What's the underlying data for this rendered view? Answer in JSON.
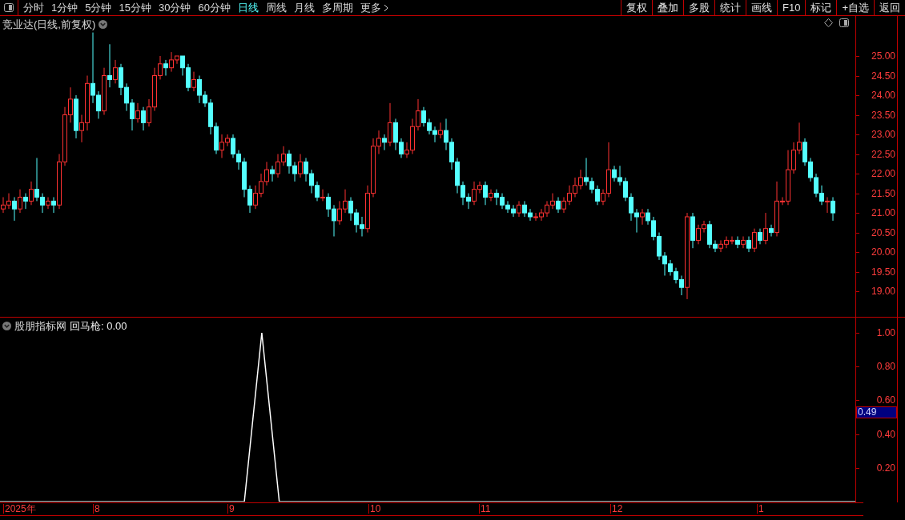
{
  "toolbar": {
    "periods": [
      {
        "label": "分时",
        "selected": false
      },
      {
        "label": "1分钟",
        "selected": false
      },
      {
        "label": "5分钟",
        "selected": false
      },
      {
        "label": "15分钟",
        "selected": false
      },
      {
        "label": "30分钟",
        "selected": false
      },
      {
        "label": "60分钟",
        "selected": false
      },
      {
        "label": "日线",
        "selected": true
      },
      {
        "label": "周线",
        "selected": false
      },
      {
        "label": "月线",
        "selected": false
      },
      {
        "label": "多周期",
        "selected": false
      }
    ],
    "more": "更多",
    "actions": [
      "复权",
      "叠加",
      "多股",
      "统计",
      "画线",
      "F10",
      "标记",
      "+自选",
      "返回"
    ]
  },
  "price_panel": {
    "title": "竞业达(日线,前复权)",
    "chart_data": {
      "type": "candlestick",
      "ylim": [
        18.35,
        26.02
      ],
      "yticks": [
        {
          "value": 25,
          "label": "25.00"
        },
        {
          "value": 24.5,
          "label": "24.50"
        },
        {
          "value": 24,
          "label": "24.00"
        },
        {
          "value": 23.5,
          "label": "23.50"
        },
        {
          "value": 23,
          "label": "23.00"
        },
        {
          "value": 22.5,
          "label": "22.50"
        },
        {
          "value": 22,
          "label": "22.00"
        },
        {
          "value": 21.5,
          "label": "21.50"
        },
        {
          "value": 21,
          "label": "21.00"
        },
        {
          "value": 20.5,
          "label": "20.50"
        },
        {
          "value": 20,
          "label": "20.00"
        },
        {
          "value": 19.5,
          "label": "19.50"
        },
        {
          "value": 19,
          "label": "19.00"
        }
      ],
      "ohlc": [
        [
          21.1,
          21.4,
          21.0,
          21.2
        ],
        [
          21.2,
          21.5,
          21.1,
          21.3
        ],
        [
          21.3,
          21.4,
          20.8,
          21.1
        ],
        [
          21.1,
          21.6,
          21.0,
          21.4
        ],
        [
          21.4,
          21.5,
          21.1,
          21.3
        ],
        [
          21.3,
          21.8,
          21.2,
          21.6
        ],
        [
          21.6,
          22.4,
          21.3,
          21.4
        ],
        [
          21.4,
          21.5,
          21.0,
          21.2
        ],
        [
          21.2,
          21.4,
          21.1,
          21.3
        ],
        [
          21.3,
          21.4,
          21.0,
          21.2
        ],
        [
          21.2,
          22.5,
          21.1,
          22.3
        ],
        [
          22.3,
          23.7,
          22.2,
          23.5
        ],
        [
          23.5,
          24.2,
          23.3,
          23.9
        ],
        [
          23.9,
          24.0,
          22.9,
          23.1
        ],
        [
          23.1,
          23.5,
          22.8,
          23.3
        ],
        [
          23.3,
          24.5,
          23.1,
          24.3
        ],
        [
          24.3,
          25.6,
          23.8,
          24.0
        ],
        [
          24.0,
          24.1,
          23.4,
          23.6
        ],
        [
          23.6,
          24.7,
          23.5,
          24.5
        ],
        [
          24.5,
          25.3,
          24.2,
          24.4
        ],
        [
          24.4,
          24.9,
          24.3,
          24.7
        ],
        [
          24.7,
          24.8,
          24.0,
          24.2
        ],
        [
          24.2,
          24.3,
          23.6,
          23.8
        ],
        [
          23.8,
          23.9,
          23.1,
          23.4
        ],
        [
          23.4,
          23.8,
          23.3,
          23.6
        ],
        [
          23.6,
          23.7,
          23.1,
          23.3
        ],
        [
          23.3,
          23.9,
          23.2,
          23.7
        ],
        [
          23.7,
          24.7,
          23.6,
          24.5
        ],
        [
          24.5,
          25.0,
          24.4,
          24.8
        ],
        [
          24.8,
          24.9,
          24.5,
          24.7
        ],
        [
          24.7,
          25.1,
          24.6,
          24.9
        ],
        [
          24.9,
          25.0,
          24.8,
          25.0
        ],
        [
          25.0,
          25.0,
          24.5,
          24.7
        ],
        [
          24.7,
          24.8,
          24.1,
          24.2
        ],
        [
          24.2,
          24.6,
          24.1,
          24.4
        ],
        [
          24.4,
          24.5,
          23.8,
          24.0
        ],
        [
          24.0,
          24.1,
          23.7,
          23.8
        ],
        [
          23.8,
          23.9,
          23.0,
          23.2
        ],
        [
          23.2,
          23.3,
          22.5,
          22.6
        ],
        [
          22.6,
          23.0,
          22.4,
          22.8
        ],
        [
          22.8,
          23.0,
          22.7,
          22.9
        ],
        [
          22.9,
          23.0,
          22.4,
          22.5
        ],
        [
          22.5,
          22.6,
          22.1,
          22.3
        ],
        [
          22.3,
          22.4,
          21.4,
          21.6
        ],
        [
          21.6,
          21.7,
          21.0,
          21.2
        ],
        [
          21.2,
          21.7,
          21.1,
          21.5
        ],
        [
          21.5,
          22.0,
          21.4,
          21.8
        ],
        [
          21.8,
          22.3,
          21.7,
          22.1
        ],
        [
          22.1,
          22.2,
          21.8,
          22.0
        ],
        [
          22.0,
          22.5,
          21.9,
          22.3
        ],
        [
          22.3,
          22.7,
          22.2,
          22.5
        ],
        [
          22.5,
          22.6,
          22.0,
          22.2
        ],
        [
          22.2,
          22.3,
          21.8,
          22.0
        ],
        [
          22.0,
          22.5,
          21.9,
          22.3
        ],
        [
          22.3,
          22.4,
          21.8,
          22.0
        ],
        [
          22.0,
          22.1,
          21.5,
          21.7
        ],
        [
          21.7,
          21.8,
          21.3,
          21.4
        ],
        [
          21.4,
          21.6,
          21.3,
          21.4
        ],
        [
          21.4,
          21.5,
          20.9,
          21.1
        ],
        [
          21.1,
          21.2,
          20.4,
          20.8
        ],
        [
          20.8,
          21.3,
          20.7,
          21.1
        ],
        [
          21.1,
          21.6,
          21.0,
          21.3
        ],
        [
          21.3,
          21.4,
          20.8,
          21.0
        ],
        [
          21.0,
          21.1,
          20.5,
          20.7
        ],
        [
          20.7,
          20.9,
          20.4,
          20.6
        ],
        [
          20.6,
          21.7,
          20.5,
          21.5
        ],
        [
          21.5,
          22.9,
          21.4,
          22.7
        ],
        [
          22.7,
          23.1,
          22.5,
          22.9
        ],
        [
          22.9,
          23.0,
          22.6,
          22.8
        ],
        [
          22.8,
          23.8,
          22.7,
          23.3
        ],
        [
          23.3,
          23.4,
          22.6,
          22.8
        ],
        [
          22.8,
          22.9,
          22.4,
          22.5
        ],
        [
          22.5,
          22.8,
          22.4,
          22.6
        ],
        [
          22.6,
          23.4,
          22.5,
          23.2
        ],
        [
          23.2,
          23.9,
          23.1,
          23.6
        ],
        [
          23.6,
          23.7,
          23.2,
          23.3
        ],
        [
          23.3,
          23.4,
          23.0,
          23.1
        ],
        [
          23.1,
          23.2,
          22.8,
          23.0
        ],
        [
          23.0,
          23.3,
          22.9,
          23.1
        ],
        [
          23.1,
          23.4,
          22.6,
          22.8
        ],
        [
          22.8,
          22.9,
          22.1,
          22.3
        ],
        [
          22.3,
          22.4,
          21.5,
          21.7
        ],
        [
          21.7,
          21.8,
          21.2,
          21.4
        ],
        [
          21.4,
          21.5,
          21.1,
          21.3
        ],
        [
          21.3,
          21.8,
          21.2,
          21.6
        ],
        [
          21.6,
          21.8,
          21.5,
          21.7
        ],
        [
          21.7,
          21.8,
          21.2,
          21.4
        ],
        [
          21.4,
          21.6,
          21.3,
          21.5
        ],
        [
          21.5,
          21.6,
          21.2,
          21.4
        ],
        [
          21.4,
          21.5,
          21.1,
          21.2
        ],
        [
          21.2,
          21.3,
          21.0,
          21.1
        ],
        [
          21.1,
          21.2,
          20.9,
          21.0
        ],
        [
          21.0,
          21.3,
          20.9,
          21.2
        ],
        [
          21.2,
          21.3,
          20.9,
          21.0
        ],
        [
          21.0,
          21.1,
          20.8,
          20.9
        ],
        [
          20.9,
          21.0,
          20.8,
          20.9
        ],
        [
          20.9,
          21.1,
          20.8,
          21.0
        ],
        [
          21.0,
          21.3,
          20.9,
          21.2
        ],
        [
          21.2,
          21.5,
          21.1,
          21.3
        ],
        [
          21.3,
          21.4,
          21.0,
          21.1
        ],
        [
          21.1,
          21.4,
          21.0,
          21.3
        ],
        [
          21.3,
          21.7,
          21.2,
          21.5
        ],
        [
          21.5,
          21.9,
          21.4,
          21.7
        ],
        [
          21.7,
          22.1,
          21.6,
          21.9
        ],
        [
          21.9,
          22.4,
          21.7,
          21.8
        ],
        [
          21.8,
          21.9,
          21.5,
          21.6
        ],
        [
          21.6,
          21.7,
          21.2,
          21.3
        ],
        [
          21.3,
          21.6,
          21.2,
          21.5
        ],
        [
          21.5,
          22.8,
          21.4,
          22.1
        ],
        [
          22.1,
          22.2,
          21.8,
          21.9
        ],
        [
          21.9,
          22.2,
          21.7,
          21.8
        ],
        [
          21.8,
          21.9,
          21.3,
          21.4
        ],
        [
          21.4,
          21.5,
          20.8,
          21.0
        ],
        [
          21.0,
          21.1,
          20.5,
          20.9
        ],
        [
          20.9,
          21.1,
          20.7,
          21.0
        ],
        [
          21.0,
          21.1,
          20.7,
          20.8
        ],
        [
          20.8,
          20.9,
          20.3,
          20.4
        ],
        [
          20.4,
          20.5,
          19.8,
          19.9
        ],
        [
          19.9,
          20.0,
          19.4,
          19.7
        ],
        [
          19.7,
          19.8,
          19.4,
          19.5
        ],
        [
          19.5,
          19.6,
          19.2,
          19.3
        ],
        [
          19.3,
          19.4,
          18.9,
          19.1
        ],
        [
          19.1,
          21.0,
          18.8,
          20.9
        ],
        [
          20.9,
          21.0,
          20.1,
          20.3
        ],
        [
          20.3,
          20.7,
          20.2,
          20.6
        ],
        [
          20.6,
          20.8,
          20.5,
          20.7
        ],
        [
          20.7,
          20.8,
          20.1,
          20.2
        ],
        [
          20.2,
          20.3,
          20.0,
          20.1
        ],
        [
          20.1,
          20.3,
          20.0,
          20.2
        ],
        [
          20.2,
          20.4,
          20.1,
          20.3
        ],
        [
          20.3,
          20.4,
          20.2,
          20.3
        ],
        [
          20.3,
          20.4,
          20.1,
          20.2
        ],
        [
          20.2,
          20.4,
          20.1,
          20.3
        ],
        [
          20.3,
          20.4,
          20.0,
          20.1
        ],
        [
          20.1,
          20.6,
          20.0,
          20.5
        ],
        [
          20.5,
          20.6,
          20.2,
          20.3
        ],
        [
          20.3,
          21.0,
          20.2,
          20.6
        ],
        [
          20.6,
          20.7,
          20.4,
          20.5
        ],
        [
          20.5,
          21.8,
          20.4,
          21.3
        ],
        [
          21.3,
          21.4,
          21.2,
          21.3
        ],
        [
          21.3,
          22.6,
          21.2,
          22.1
        ],
        [
          22.1,
          22.8,
          22.0,
          22.6
        ],
        [
          22.6,
          23.3,
          22.5,
          22.8
        ],
        [
          22.8,
          22.9,
          22.2,
          22.3
        ],
        [
          22.3,
          22.4,
          21.8,
          21.9
        ],
        [
          21.9,
          22.0,
          21.4,
          21.5
        ],
        [
          21.5,
          21.7,
          21.2,
          21.3
        ],
        [
          21.3,
          21.4,
          21.0,
          21.3
        ],
        [
          21.3,
          21.4,
          20.8,
          21.0
        ]
      ]
    }
  },
  "time_axis": {
    "labels": [
      "2025年",
      "8",
      "9",
      "10",
      "11",
      "12",
      "1"
    ]
  },
  "indicator_panel": {
    "source": "股朋指标网",
    "reading": "回马枪: 0.00",
    "cursor_value": "0.49",
    "chart_data": {
      "type": "line",
      "ylim": [
        0,
        1.09
      ],
      "yticks": [
        {
          "value": 0.2,
          "label": "0.20"
        },
        {
          "value": 0.4,
          "label": "0.40"
        },
        {
          "value": 0.6,
          "label": "0.60"
        },
        {
          "value": 0.8,
          "label": "0.80"
        },
        {
          "value": 1,
          "label": "1.00"
        }
      ],
      "series": [
        {
          "color": "#ffffff",
          "values": [
            0,
            0,
            0,
            0,
            0,
            0,
            0,
            0,
            0,
            0,
            0,
            0,
            0,
            0,
            0,
            1,
            0,
            0,
            0,
            0,
            0,
            0,
            0,
            0,
            0,
            0,
            0,
            0,
            0,
            0,
            0,
            0,
            0,
            0,
            0,
            0,
            0,
            0,
            0,
            0,
            0,
            0,
            0,
            0,
            0,
            0,
            0,
            0,
            0,
            0
          ]
        }
      ]
    }
  }
}
